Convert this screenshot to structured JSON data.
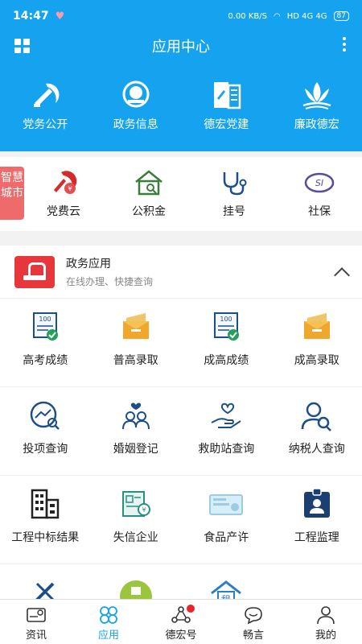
{
  "status": {
    "time": "14:47",
    "speed": "0.00 KB/S",
    "network": "HD 4G 4G",
    "battery": "87"
  },
  "header": {
    "title": "应用中心"
  },
  "top_tiles": [
    {
      "label": "党务公开",
      "icon": "party-emblem-icon"
    },
    {
      "label": "政务信息",
      "icon": "national-emblem-icon"
    },
    {
      "label": "德宏党建",
      "icon": "party-building-book-icon"
    },
    {
      "label": "廉政德宏",
      "icon": "lotus-icon"
    }
  ],
  "smart_city": {
    "tag": "智慧城市",
    "items": [
      {
        "label": "党费云",
        "icon": "party-fee-icon"
      },
      {
        "label": "公积金",
        "icon": "housing-fund-icon"
      },
      {
        "label": "挂号",
        "icon": "stethoscope-icon"
      },
      {
        "label": "社保",
        "icon": "social-security-icon"
      }
    ]
  },
  "gov": {
    "title": "政务应用",
    "subtitle": "在线办理、快捷查询",
    "rows": [
      [
        {
          "label": "高考成绩",
          "icon": "exam-score-icon"
        },
        {
          "label": "普高录取",
          "icon": "admission-folder-icon"
        },
        {
          "label": "成高成绩",
          "icon": "exam-score-icon"
        },
        {
          "label": "成高录取",
          "icon": "admission-folder-icon"
        }
      ],
      [
        {
          "label": "投项查询",
          "icon": "investment-search-icon"
        },
        {
          "label": "婚姻登记",
          "icon": "marriage-icon"
        },
        {
          "label": "救助站查询",
          "icon": "aid-hand-icon"
        },
        {
          "label": "纳税人查询",
          "icon": "taxpayer-search-icon"
        }
      ],
      [
        {
          "label": "工程中标结果",
          "icon": "buildings-icon"
        },
        {
          "label": "失信企业",
          "icon": "credit-doc-icon"
        },
        {
          "label": "食品产许",
          "icon": "food-license-icon"
        },
        {
          "label": "工程监理",
          "icon": "badge-icon"
        }
      ],
      [
        {
          "label": "",
          "icon": "pencil-ruler-icon"
        },
        {
          "label": "",
          "icon": "green-circle-icon"
        },
        {
          "label": "",
          "icon": "rent-house-icon"
        },
        {
          "label": "",
          "icon": ""
        }
      ]
    ]
  },
  "bottom_nav": [
    {
      "label": "资讯",
      "icon": "news-icon"
    },
    {
      "label": "应用",
      "icon": "apps-icon",
      "active": true
    },
    {
      "label": "德宏号",
      "icon": "share-icon",
      "badge": true
    },
    {
      "label": "畅言",
      "icon": "chat-icon"
    },
    {
      "label": "我的",
      "icon": "profile-icon"
    }
  ],
  "colors": {
    "header": "#15a3f0",
    "accent": "#15a3f0",
    "red": "#e8363d"
  }
}
